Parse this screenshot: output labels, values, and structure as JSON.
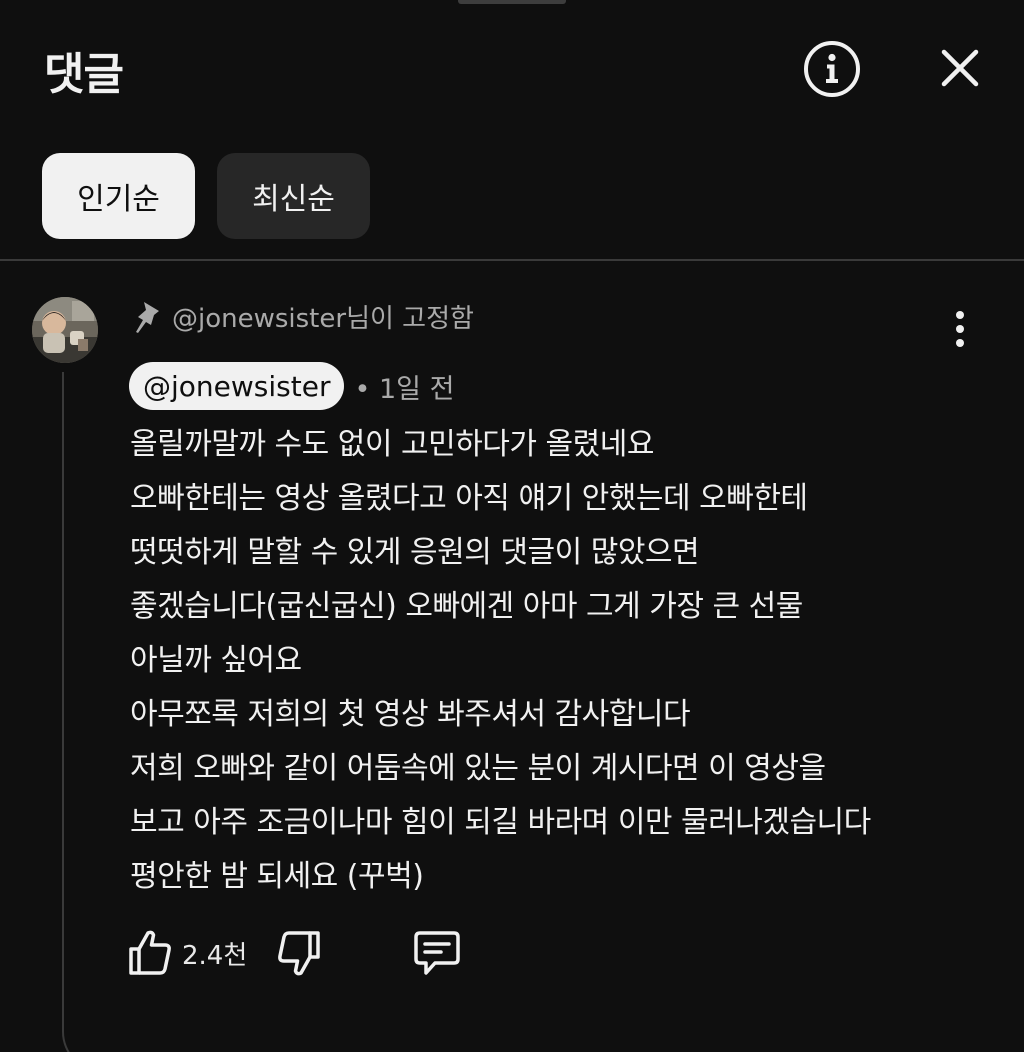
{
  "header": {
    "title": "댓글",
    "info_icon": "info-icon",
    "close_icon": "close-icon"
  },
  "sort_tabs": [
    {
      "label": "인기순",
      "selected": true
    },
    {
      "label": "최신순",
      "selected": false
    }
  ],
  "comment": {
    "pinned_text": "@jonewsister님이 고정함",
    "author": "@jonewsister",
    "time": "• 1일 전",
    "lines": [
      "올릴까말까 수도 없이 고민하다가 올렸네요",
      "오빠한테는 영상 올렸다고 아직 얘기 안했는데 오빠한테",
      "떳떳하게 말할 수 있게 응원의 댓글이 많았으면",
      "좋겠습니다(굽신굽신) 오빠에겐 아마 그게 가장 큰 선물",
      "아닐까 싶어요",
      "아무쪼록 저희의 첫 영상 봐주셔서 감사합니다",
      "저희 오빠와 같이 어둠속에 있는 분이 계시다면 이 영상을",
      "보고 아주 조금이나마 힘이 되길 바라며 이만 물러나겠습니다",
      "평안한 밤 되세요 (꾸벅)"
    ],
    "like_count": "2.4천"
  },
  "colors": {
    "background": "#0f0f0f",
    "text_primary": "#f1f1f1",
    "text_secondary": "#aaaaaa",
    "chip_inactive": "#272727"
  }
}
